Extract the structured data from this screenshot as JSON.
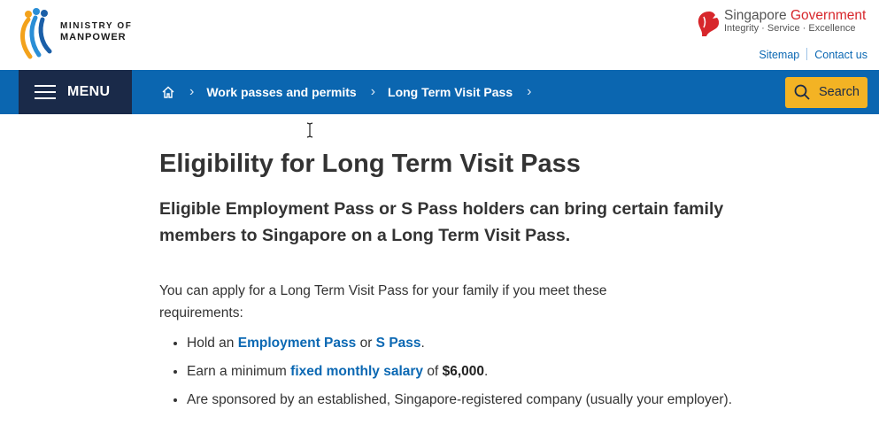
{
  "header": {
    "ministry_line1": "MINISTRY OF",
    "ministry_line2": "MANPOWER",
    "gov_prefix": "Singapore",
    "gov_suffix": "Government",
    "gov_tagline": "Integrity · Service · Excellence",
    "sitemap_label": "Sitemap",
    "contact_label": "Contact us"
  },
  "nav": {
    "menu_label": "MENU",
    "breadcrumb": [
      "Work passes and permits",
      "Long Term Visit Pass"
    ],
    "search_label": "Search"
  },
  "content": {
    "title": "Eligibility for Long Term Visit Pass",
    "lead": "Eligible Employment Pass or S Pass holders can bring certain family members to Singapore on a Long Term Visit Pass.",
    "intro": "You can apply for a Long Term Visit Pass for your family if you meet these requirements:",
    "req1": {
      "pre": "Hold an ",
      "link1": "Employment Pass",
      "mid": " or ",
      "link2": "S Pass",
      "post": "."
    },
    "req2": {
      "pre": "Earn a minimum ",
      "link": "fixed monthly salary",
      "mid": " of ",
      "amount": "$6,000",
      "post": "."
    },
    "req3": "Are sponsored by an established, Singapore-registered company (usually your employer)."
  },
  "colors": {
    "nav_blue": "#0b66b0",
    "menu_navy": "#1a2a49",
    "search_yellow": "#f3b324",
    "link_blue": "#0b68b3",
    "gov_red": "#d7262b"
  },
  "icons": [
    "mom-logo",
    "lion-head-icon",
    "hamburger-icon",
    "home-icon",
    "chevron-right-icon",
    "search-icon",
    "text-cursor-icon"
  ]
}
